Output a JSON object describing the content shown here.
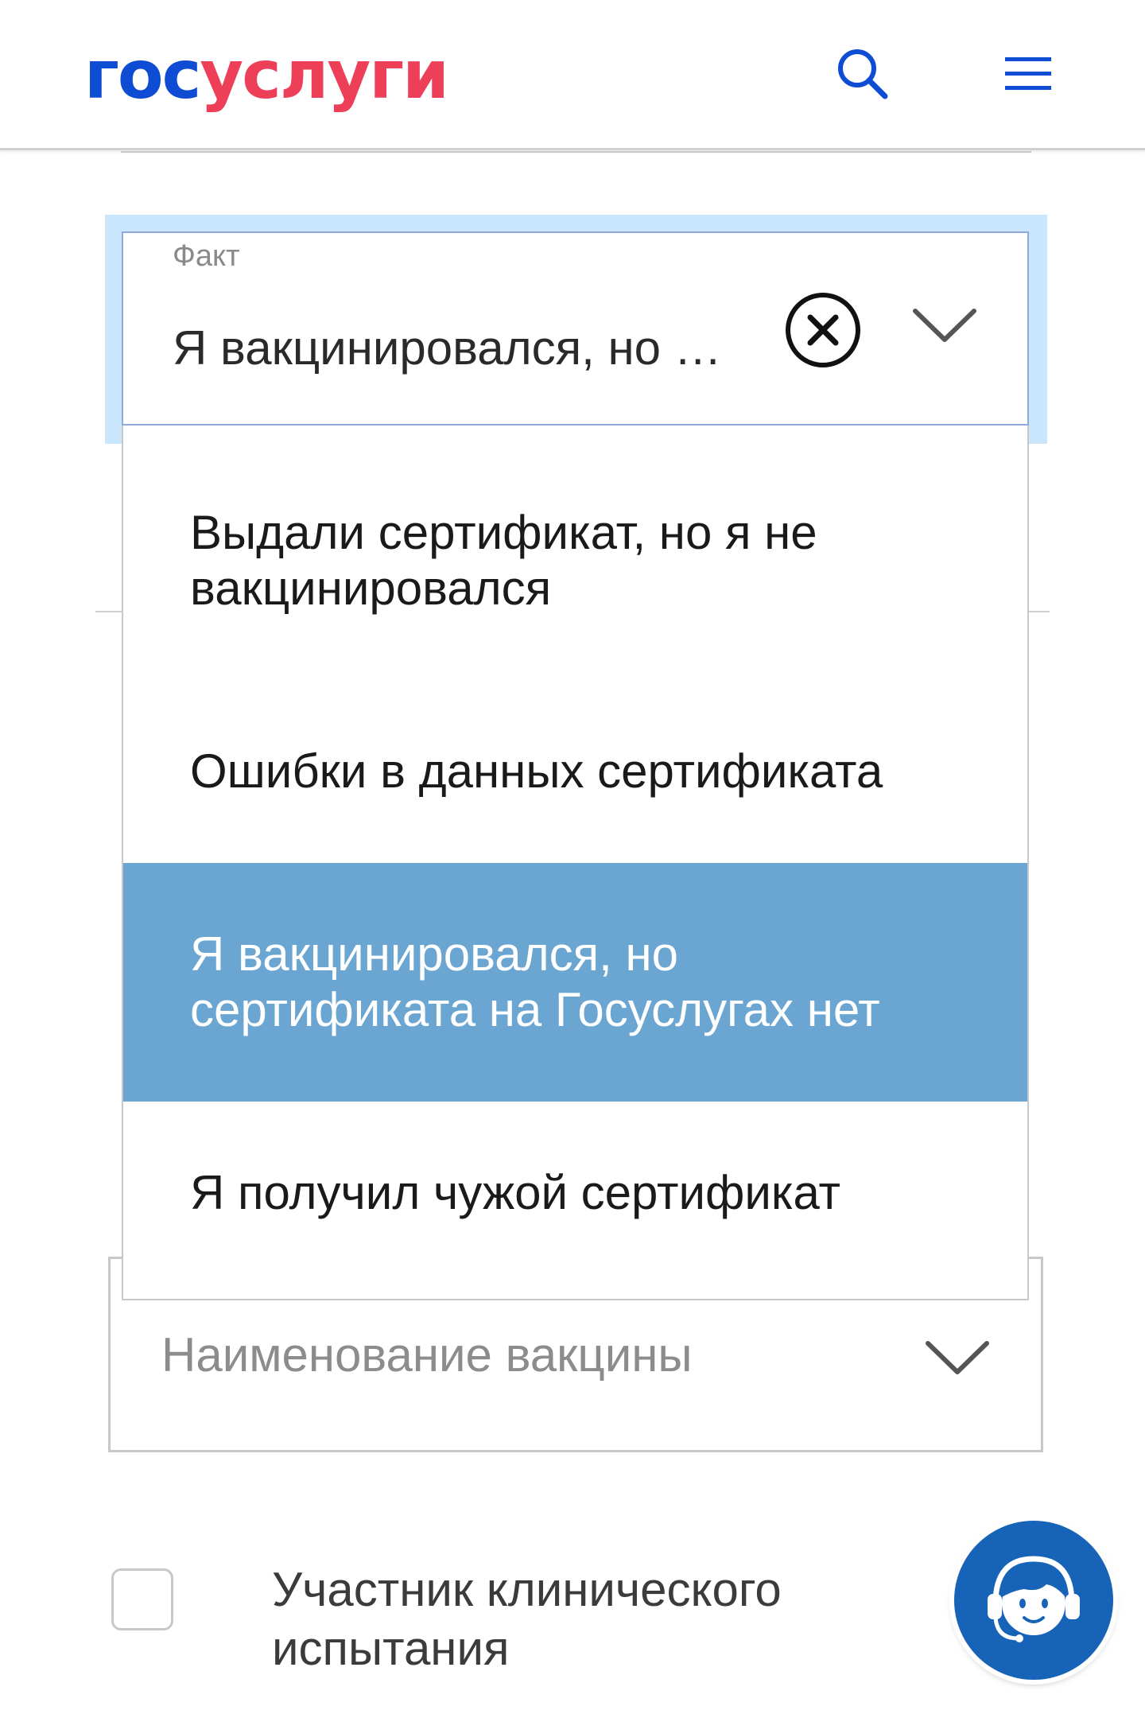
{
  "header": {
    "logo_part1": "гос",
    "logo_part2": "услуги",
    "brand_blue": "#0d4cd3",
    "brand_red": "#ee3f58",
    "icons": [
      "search-icon",
      "menu-icon"
    ]
  },
  "fact_field": {
    "label": "Факт",
    "value": "Я вакцинировался, но …",
    "icons": [
      "clear-icon",
      "chevron-down-icon"
    ]
  },
  "dropdown": {
    "options": [
      "Выдали сертификат, но я не вакцинировался",
      "Ошибки в данных сертификата",
      "Я вакцинировался, но сертификата на Госуслугах нет",
      "Я получил чужой сертификат"
    ],
    "selected_index": 2,
    "selected_color": "#6ba6d2"
  },
  "vaccine_field": {
    "placeholder": "Наименование вакцины"
  },
  "clinical_trial": {
    "label": "Участник клинического испытания",
    "checked": false
  },
  "support": {
    "icon": "support-operator-icon",
    "color": "#1663b8"
  }
}
